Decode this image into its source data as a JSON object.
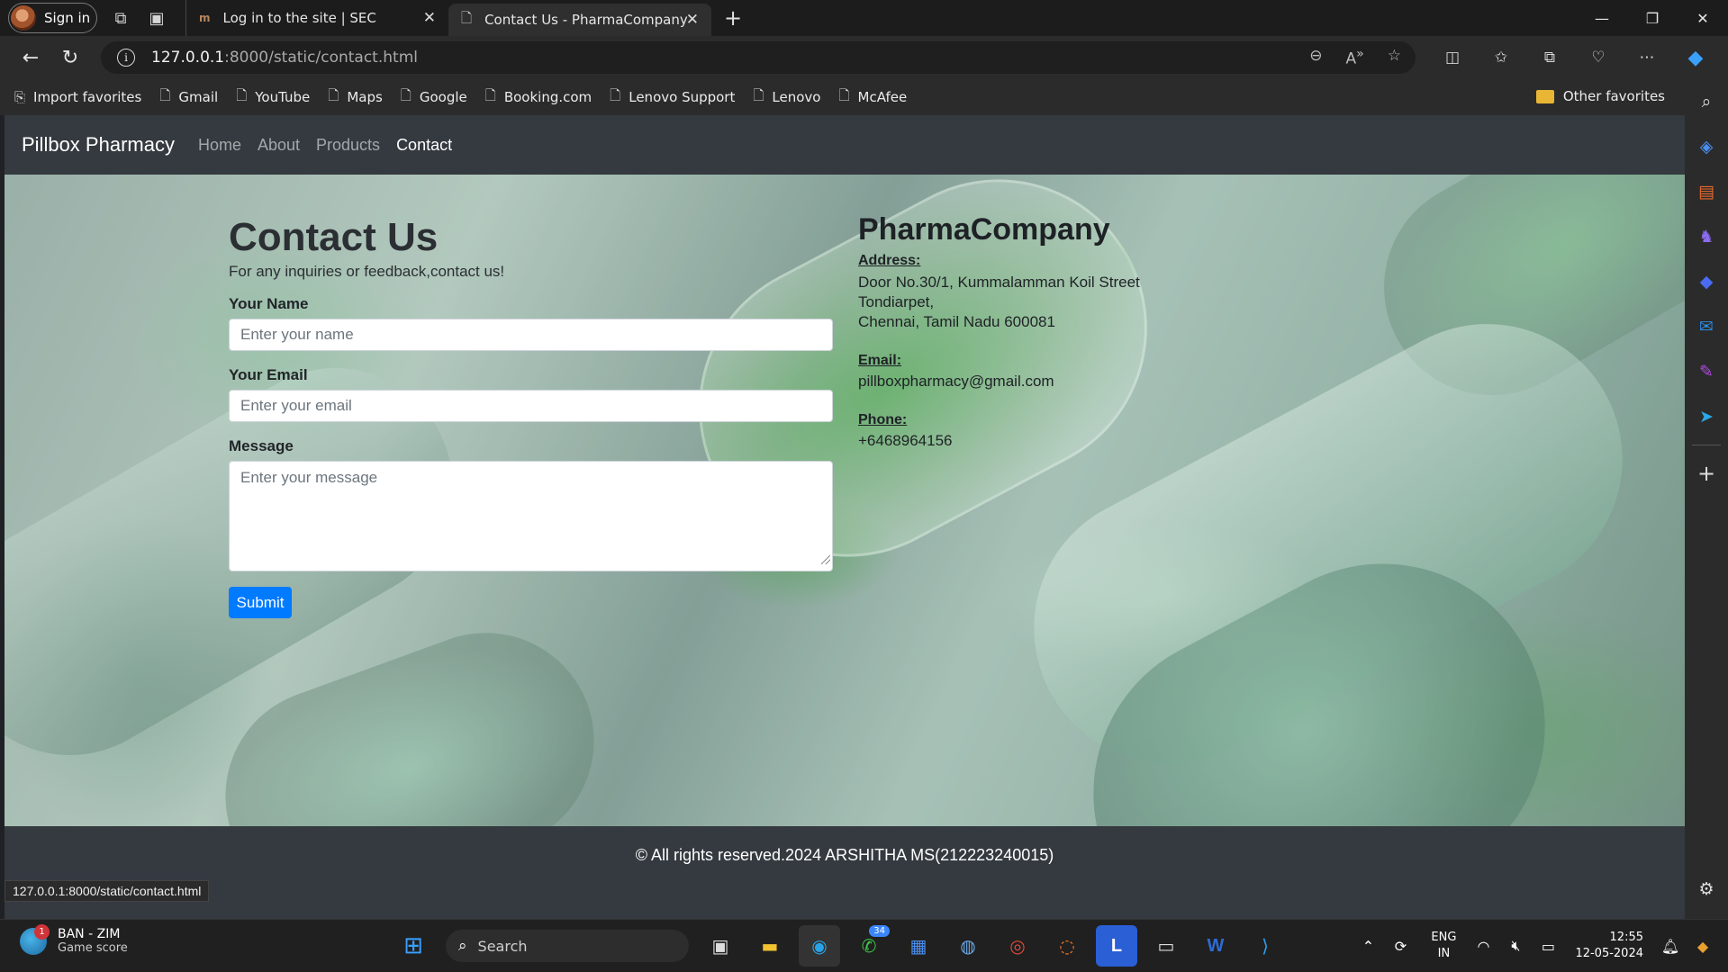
{
  "browser": {
    "signin_label": "Sign in",
    "tabs": [
      {
        "title": "Log in to the site | SEC",
        "icon": "m"
      },
      {
        "title": "Contact Us - PharmaCompany"
      }
    ],
    "url_host": "127.0.0.1",
    "url_path": ":8000/static/contact.html",
    "favorites": [
      {
        "label": "Import favorites",
        "icon": "import-icon"
      },
      {
        "label": "Gmail"
      },
      {
        "label": "YouTube"
      },
      {
        "label": "Maps"
      },
      {
        "label": "Google"
      },
      {
        "label": "Booking.com"
      },
      {
        "label": "Lenovo Support"
      },
      {
        "label": "Lenovo"
      },
      {
        "label": "McAfee"
      }
    ],
    "other_favorites": "Other favorites",
    "status_url": "127.0.0.1:8000/static/contact.html"
  },
  "site": {
    "brand": "Pillbox Pharmacy",
    "nav": [
      "Home",
      "About",
      "Products",
      "Contact"
    ],
    "active_nav": "Contact"
  },
  "form": {
    "title": "Contact Us",
    "subtitle": "For any inquiries or feedback,contact us!",
    "name_label": "Your Name",
    "name_placeholder": "Enter your name",
    "email_label": "Your Email",
    "email_placeholder": "Enter your email",
    "message_label": "Message",
    "message_placeholder": "Enter your message",
    "submit_label": "Submit"
  },
  "company": {
    "name": "PharmaCompany",
    "address_label": "Address:",
    "address_lines": [
      "Door No.30/1, Kummalamman Koil Street",
      "Tondiarpet,",
      "Chennai, Tamil Nadu 600081"
    ],
    "email_label": "Email:",
    "email": "pillboxpharmacy@gmail.com",
    "phone_label": "Phone:",
    "phone": "+6468964156"
  },
  "footer": {
    "text": "© All rights reserved.2024 ARSHITHA MS(212223240015)"
  },
  "taskbar": {
    "weather_title": "BAN - ZIM",
    "weather_sub": "Game score",
    "weather_badge": "1",
    "search_label": "Search",
    "whatsapp_badge": "34",
    "lang_top": "ENG",
    "lang_bottom": "IN",
    "time": "12:55",
    "date": "12-05-2024"
  }
}
